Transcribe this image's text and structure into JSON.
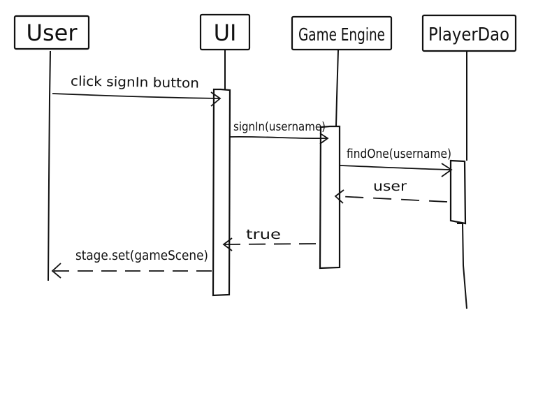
{
  "participants": [
    {
      "id": "user",
      "name": "User"
    },
    {
      "id": "ui",
      "name": "UI"
    },
    {
      "id": "engine",
      "name": "Game Engine"
    },
    {
      "id": "dao",
      "name": "PlayerDao"
    }
  ],
  "messages": [
    {
      "from": "user",
      "to": "ui",
      "label": "click signIn button",
      "kind": "call"
    },
    {
      "from": "ui",
      "to": "engine",
      "label": "signIn(username)",
      "kind": "call"
    },
    {
      "from": "engine",
      "to": "dao",
      "label": "findOne(username)",
      "kind": "call"
    },
    {
      "from": "dao",
      "to": "engine",
      "label": "user",
      "kind": "return"
    },
    {
      "from": "engine",
      "to": "ui",
      "label": "true",
      "kind": "return"
    },
    {
      "from": "ui",
      "to": "user",
      "label": "stage.set(gameScene)",
      "kind": "return"
    }
  ],
  "colors": {
    "ink": "#111111",
    "background": "#ffffff"
  }
}
